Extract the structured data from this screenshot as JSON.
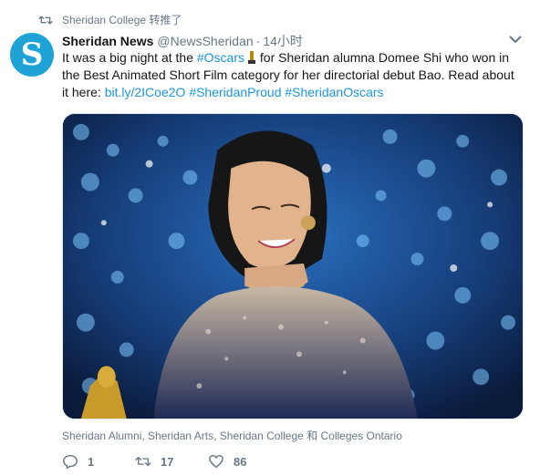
{
  "retweet_context": {
    "icon": "retweet-icon",
    "text": "Sheridan College 转推了"
  },
  "tweet": {
    "avatar_letter": "S",
    "author_name": "Sheridan News",
    "handle": "@NewsSheridan",
    "separator": "·",
    "time": "14小时",
    "text_parts": {
      "p1": "It was a big night at the ",
      "hashtag_oscars": "#Oscars",
      "p2": " for Sheridan alumna Domee Shi who won in the Best Animated Short Film category for her directorial debut Bao. Read about it here: ",
      "url": "bit.ly/2ICoe2O",
      "hashtag1": "#SheridanProud",
      "hashtag2": "#SheridanOscars"
    },
    "tagged_people": "Sheridan Alumni, Sheridan Arts, Sheridan College 和 Colleges Ontario",
    "actions": {
      "reply_count": "1",
      "retweet_count": "17",
      "like_count": "86"
    }
  },
  "colors": {
    "link": "#1b95e0",
    "secondary_text": "#657786",
    "avatar_bg": "#1fa3d6"
  }
}
